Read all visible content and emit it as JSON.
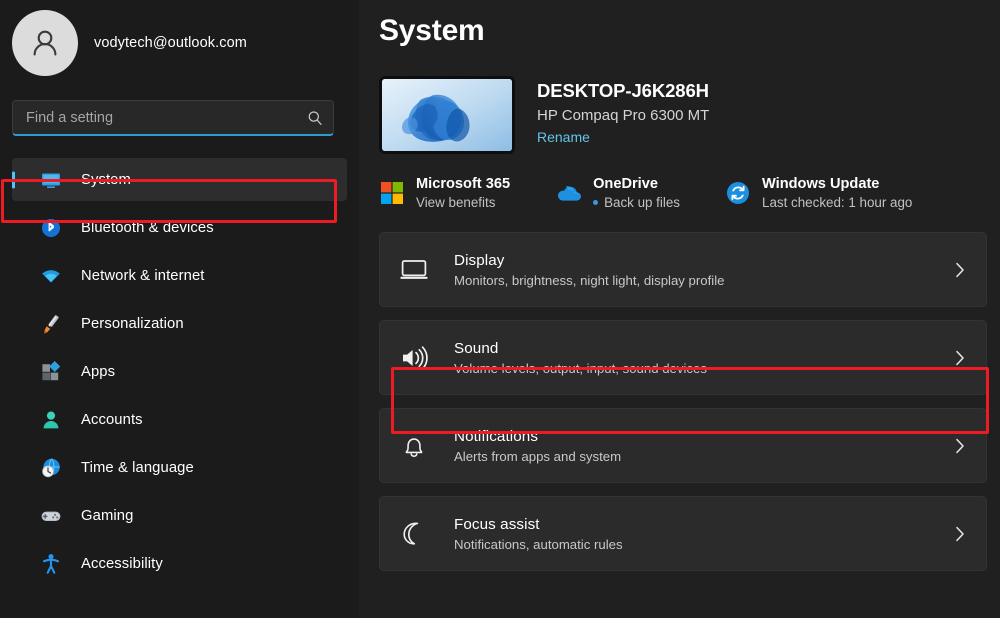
{
  "account": {
    "email": "vodytech@outlook.com",
    "avatar_icon": "person-avatar-icon"
  },
  "search": {
    "placeholder": "Find a setting",
    "value": "",
    "icon": "search-icon"
  },
  "sidebar": {
    "items": [
      {
        "label": "System",
        "icon": "monitor-icon",
        "selected": true
      },
      {
        "label": "Bluetooth & devices",
        "icon": "bluetooth-icon",
        "selected": false
      },
      {
        "label": "Network & internet",
        "icon": "wifi-icon",
        "selected": false
      },
      {
        "label": "Personalization",
        "icon": "paintbrush-icon",
        "selected": false
      },
      {
        "label": "Apps",
        "icon": "apps-blocks-icon",
        "selected": false
      },
      {
        "label": "Accounts",
        "icon": "person-icon",
        "selected": false
      },
      {
        "label": "Time & language",
        "icon": "clock-globe-icon",
        "selected": false
      },
      {
        "label": "Gaming",
        "icon": "gamepad-icon",
        "selected": false
      },
      {
        "label": "Accessibility",
        "icon": "accessibility-icon",
        "selected": false
      }
    ]
  },
  "main": {
    "page_title": "System",
    "device": {
      "name": "DESKTOP-J6K286H",
      "model": "HP Compaq Pro 6300 MT",
      "rename_label": "Rename",
      "thumbnail_icon": "windows-bloom-wallpaper"
    },
    "quick_links": [
      {
        "title": "Microsoft 365",
        "sub": "View benefits",
        "icon": "microsoft-logo-icon",
        "has_dot": false
      },
      {
        "title": "OneDrive",
        "sub": "Back up files",
        "icon": "onedrive-cloud-icon",
        "has_dot": true
      },
      {
        "title": "Windows Update",
        "sub": "Last checked: 1 hour ago",
        "icon": "update-sync-icon",
        "has_dot": false
      }
    ],
    "settings_rows": [
      {
        "title": "Display",
        "sub": "Monitors, brightness, night light, display profile",
        "icon": "display-monitor-icon",
        "highlighted": false
      },
      {
        "title": "Sound",
        "sub": "Volume levels, output, input, sound devices",
        "icon": "speaker-sound-icon",
        "highlighted": true
      },
      {
        "title": "Notifications",
        "sub": "Alerts from apps and system",
        "icon": "bell-icon",
        "highlighted": false
      },
      {
        "title": "Focus assist",
        "sub": "Notifications, automatic rules",
        "icon": "crescent-moon-icon",
        "highlighted": false
      }
    ],
    "chevron_icon": "chevron-right-icon"
  },
  "annotations": {
    "highlight_color": "#ed1c24",
    "targets": [
      "sidebar-item-system",
      "settings-row-sound"
    ]
  },
  "theme": {
    "accent": "#4cc2ff",
    "link": "#63c5e8",
    "sidebar_bg": "#1b1b1b",
    "content_bg": "#202020",
    "card_bg": "#2b2b2b"
  }
}
